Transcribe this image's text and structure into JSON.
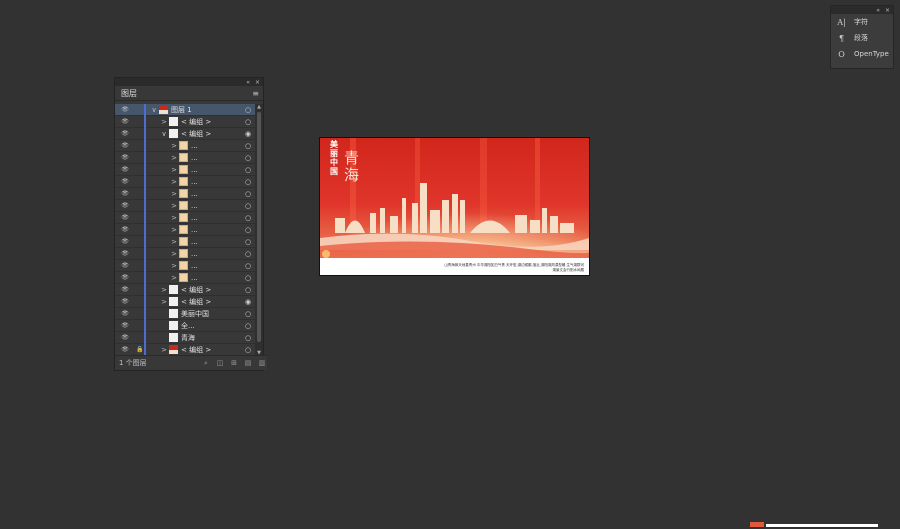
{
  "text_panel": {
    "items": [
      {
        "icon": "character-icon",
        "glyph": "A|",
        "label": "字符"
      },
      {
        "icon": "paragraph-icon",
        "glyph": "¶",
        "label": "段落"
      },
      {
        "icon": "opentype-icon",
        "glyph": "O",
        "label": "OpenType"
      }
    ],
    "collapse_glyph": "«",
    "close_glyph": "×"
  },
  "layers_panel": {
    "title": "图层",
    "menu_glyph": "≡",
    "collapse_glyph": "«",
    "close_glyph": "×",
    "rows": [
      {
        "name": "图层 1",
        "thumb": "red",
        "arrow": "∨",
        "indent": 0,
        "selected": true,
        "target": "○"
      },
      {
        "name": "< 编组 >",
        "thumb": "white",
        "arrow": ">",
        "indent": 1,
        "target": "○"
      },
      {
        "name": "< 编组 >",
        "thumb": "white",
        "arrow": "∨",
        "indent": 1,
        "target": "◉"
      },
      {
        "name": "...",
        "thumb": "orange",
        "arrow": ">",
        "indent": 2,
        "target": "○"
      },
      {
        "name": "...",
        "thumb": "orange",
        "arrow": ">",
        "indent": 2,
        "target": "○"
      },
      {
        "name": "...",
        "thumb": "orange",
        "arrow": ">",
        "indent": 2,
        "target": "○"
      },
      {
        "name": "...",
        "thumb": "orange",
        "arrow": ">",
        "indent": 2,
        "target": "○"
      },
      {
        "name": "...",
        "thumb": "orange",
        "arrow": ">",
        "indent": 2,
        "target": "○"
      },
      {
        "name": "...",
        "thumb": "orange",
        "arrow": ">",
        "indent": 2,
        "target": "○"
      },
      {
        "name": "...",
        "thumb": "orange",
        "arrow": ">",
        "indent": 2,
        "target": "○"
      },
      {
        "name": "...",
        "thumb": "orange",
        "arrow": ">",
        "indent": 2,
        "target": "○"
      },
      {
        "name": "...",
        "thumb": "orange",
        "arrow": ">",
        "indent": 2,
        "target": "○"
      },
      {
        "name": "...",
        "thumb": "orange",
        "arrow": ">",
        "indent": 2,
        "target": "○"
      },
      {
        "name": "...",
        "thumb": "orange",
        "arrow": ">",
        "indent": 2,
        "target": "○"
      },
      {
        "name": "...",
        "thumb": "orange",
        "arrow": ">",
        "indent": 2,
        "target": "○"
      },
      {
        "name": "< 编组 >",
        "thumb": "white",
        "arrow": ">",
        "indent": 1,
        "target": "○"
      },
      {
        "name": "< 编组 >",
        "thumb": "white",
        "arrow": ">",
        "indent": 1,
        "target": "◉"
      },
      {
        "name": "美丽中国",
        "thumb": "white",
        "arrow": "",
        "indent": 1,
        "target": "○"
      },
      {
        "name": "全...",
        "thumb": "white",
        "arrow": "",
        "indent": 1,
        "target": "○"
      },
      {
        "name": "青海",
        "thumb": "white",
        "arrow": "",
        "indent": 1,
        "target": "○"
      },
      {
        "name": "< 编组 >",
        "thumb": "red",
        "arrow": ">",
        "indent": 1,
        "target": "○",
        "locked": true
      }
    ],
    "footer": {
      "count_label": "1 个图层",
      "icons": [
        "locate-object-icon",
        "make-clipping-mask-icon",
        "new-sublayer-icon",
        "new-layer-icon",
        "delete-icon"
      ]
    }
  },
  "artboard": {
    "title_small": "美丽中国",
    "title_big": "青海",
    "caption": "山青海蒋天地善青州 中华湖阳如白气青 天环型,湖边候鹏,落近,湖阳湖风漠型暖 生气湖群河湖景文会行阳水间展"
  },
  "colors": {
    "background": "#323232",
    "selection": "#46566b",
    "layer_color": "#4d6ed0",
    "art_red": "#c8281e"
  }
}
